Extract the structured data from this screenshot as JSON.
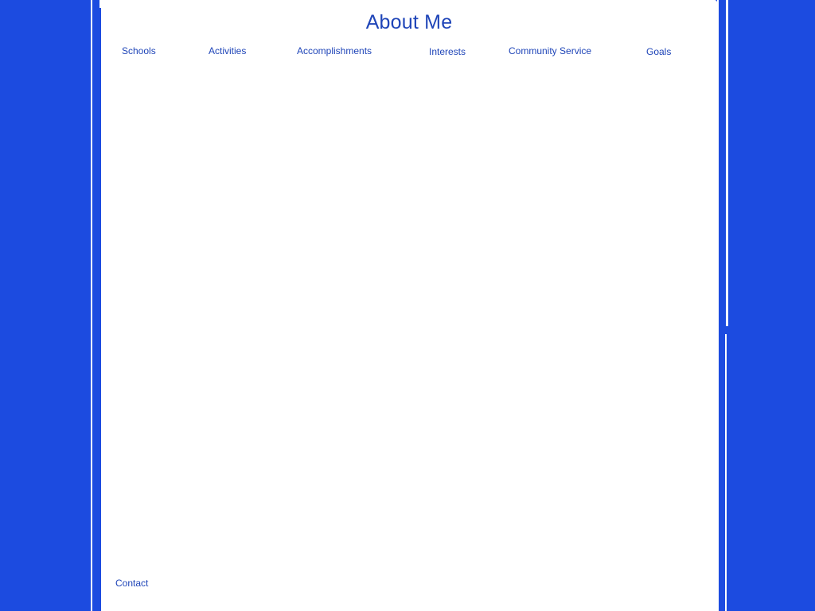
{
  "page": {
    "title": "About Me",
    "background_color": "#1c4be0",
    "accent_color": "#1f45b8"
  },
  "nav": {
    "items": [
      {
        "label": "Schools"
      },
      {
        "label": "Activities"
      },
      {
        "label": "Accomplishments"
      },
      {
        "label": "Interests"
      },
      {
        "label": "Community Service"
      },
      {
        "label": "Goals"
      }
    ]
  },
  "footer": {
    "contact_label": "Contact"
  }
}
